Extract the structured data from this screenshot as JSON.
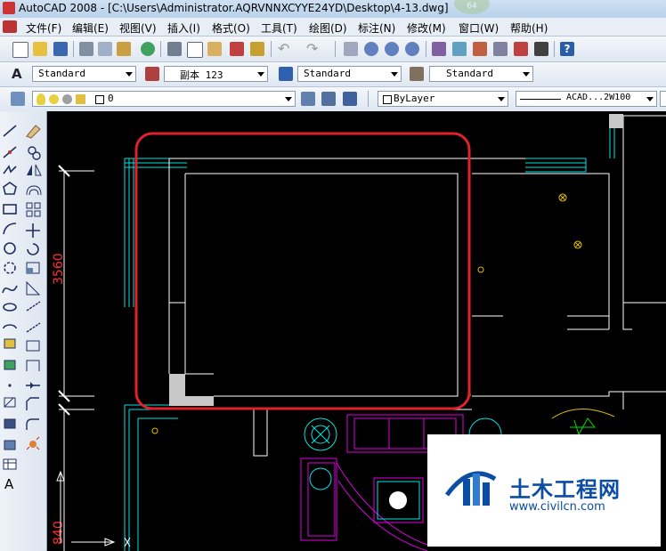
{
  "window": {
    "title": "AutoCAD 2008 - [C:\\Users\\Administrator.AQRVNNXCYYE24YD\\Desktop\\4-13.dwg]",
    "ghost_badge": "64"
  },
  "menu": [
    "文件(F)",
    "编辑(E)",
    "视图(V)",
    "插入(I)",
    "格式(O)",
    "工具(T)",
    "绘图(D)",
    "标注(N)",
    "修改(M)",
    "窗口(W)",
    "帮助(H)"
  ],
  "styles_toolbar": {
    "text_style": "Standard",
    "dim_style": "副本 123",
    "table_style": "Standard",
    "multileader_style": "Standard"
  },
  "layers_toolbar": {
    "layer": "0",
    "color": "ByLayer",
    "linetype": "ACAD...2W100"
  },
  "drawing": {
    "dimension_top": "3560",
    "dimension_bottom": "840",
    "highlight_color": "#e0202a",
    "wall_color": "#ffffff",
    "cyan_color": "#00e5e5",
    "magenta_color": "#e000e0",
    "yellow_color": "#e0c000",
    "green_color": "#00e000",
    "dim_color": "#ff3030"
  },
  "watermark": {
    "cn": "土木工程网",
    "url": "www.civilcn.com"
  }
}
